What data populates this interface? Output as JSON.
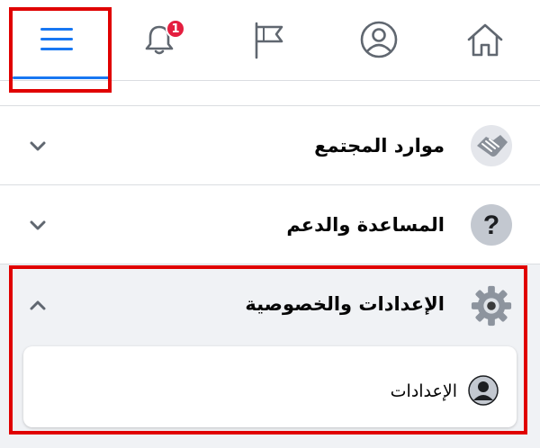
{
  "topbar": {
    "tabs": [
      {
        "name": "menu",
        "icon": "hamburger-menu-icon",
        "active": true
      },
      {
        "name": "notifications",
        "icon": "bell-icon",
        "badge": "1"
      },
      {
        "name": "pages",
        "icon": "flag-icon"
      },
      {
        "name": "profile",
        "icon": "user-circle-icon"
      },
      {
        "name": "home",
        "icon": "home-icon"
      }
    ],
    "notification_count": "1"
  },
  "menu": {
    "sections": [
      {
        "label": "موارد المجتمع",
        "icon": "handshake-icon",
        "expanded": false
      },
      {
        "label": "المساعدة والدعم",
        "icon": "question-icon",
        "expanded": false
      },
      {
        "label": "الإعدادات والخصوصية",
        "icon": "gear-icon",
        "expanded": true
      }
    ],
    "submenu": {
      "label": "الإعدادات",
      "icon": "user-avatar-icon"
    }
  },
  "colors": {
    "accent": "#1877f2",
    "badge": "#e41e3f",
    "highlight": "#e00000",
    "background": "#f0f2f5"
  }
}
